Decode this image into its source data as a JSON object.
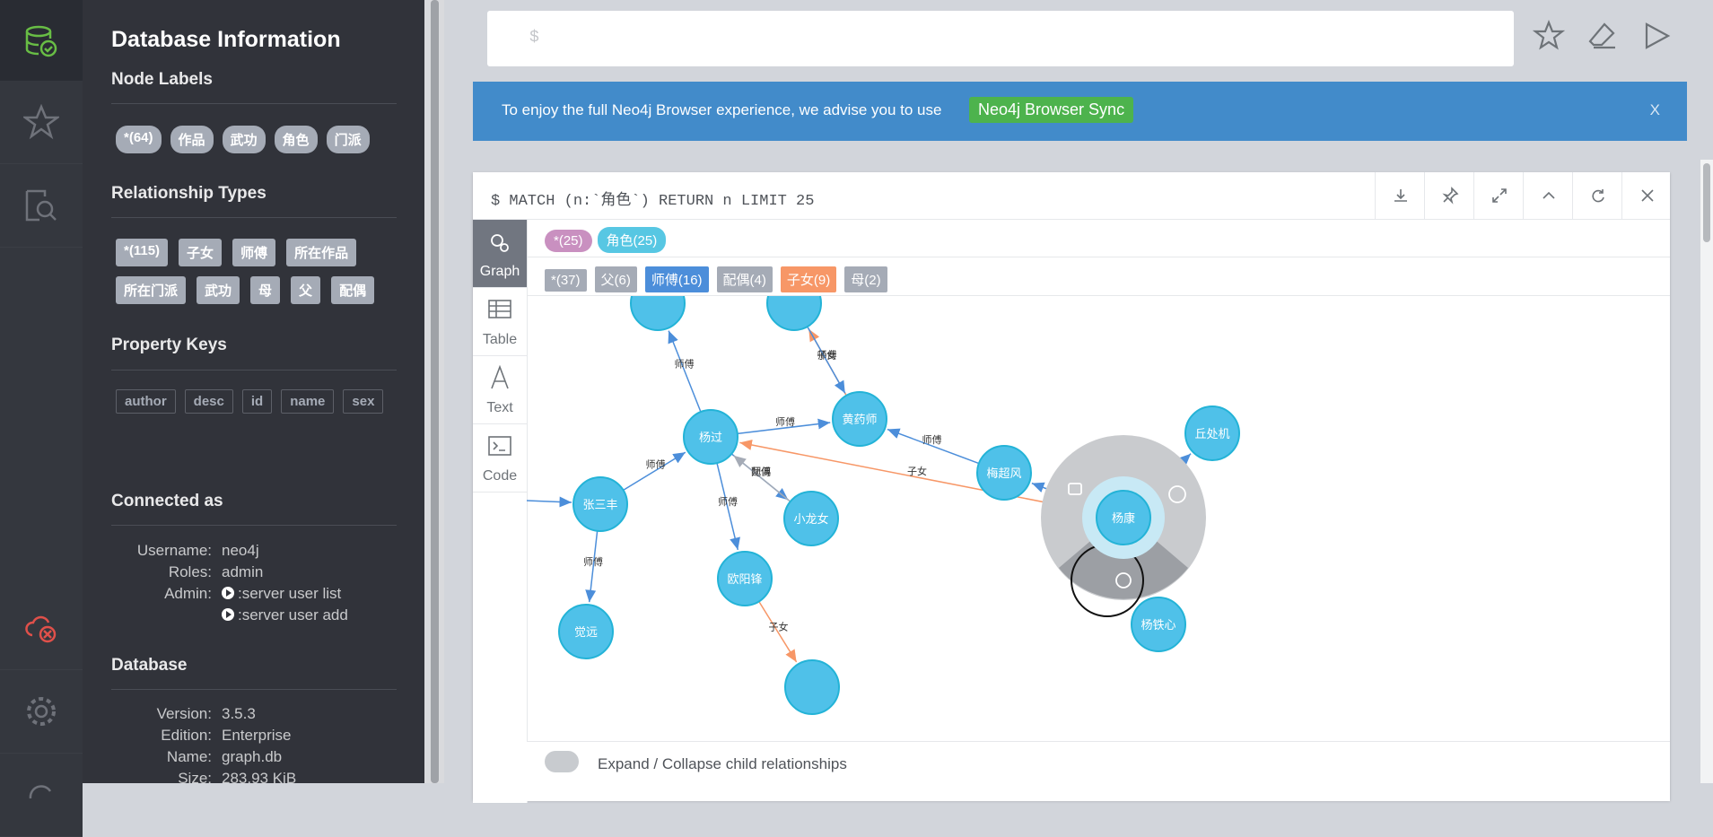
{
  "rail": {
    "items": [
      "database-icon",
      "star-icon",
      "search-doc-icon",
      "cloud-disconnected-icon",
      "gear-icon",
      "sync-icon"
    ]
  },
  "drawer": {
    "title": "Database Information",
    "node_labels": {
      "title": "Node Labels",
      "items": [
        "*(64)",
        "作品",
        "武功",
        "角色",
        "门派"
      ]
    },
    "relationship_types": {
      "title": "Relationship Types",
      "items": [
        "*(115)",
        "子女",
        "师傅",
        "所在作品",
        "所在门派",
        "武功",
        "母",
        "父",
        "配偶"
      ]
    },
    "property_keys": {
      "title": "Property Keys",
      "items": [
        "author",
        "desc",
        "id",
        "name",
        "sex"
      ]
    },
    "connected_as": {
      "title": "Connected as",
      "username_label": "Username:",
      "username": "neo4j",
      "roles_label": "Roles:",
      "roles": "admin",
      "admin_label": "Admin:",
      "admin_cmd1": ":server user list",
      "admin_cmd2": ":server user add"
    },
    "database": {
      "title": "Database",
      "version_label": "Version:",
      "version": "3.5.3",
      "edition_label": "Edition:",
      "edition": "Enterprise",
      "name_label": "Name:",
      "name": "graph.db",
      "size_label": "Size:",
      "size": "283.93 KiB"
    }
  },
  "editor": {
    "prompt": "$"
  },
  "banner": {
    "message": "To enjoy the full Neo4j Browser experience, we advise you to use",
    "sync_label": "Neo4j Browser Sync",
    "close": "X"
  },
  "frame": {
    "command": "$ MATCH (n:`角色`) RETURN n LIMIT 25",
    "tabs": [
      "Graph",
      "Table",
      "Text",
      "Code"
    ],
    "node_pills": [
      {
        "label": "*(25)",
        "color": "#c990c0"
      },
      {
        "label": "角色(25)",
        "color": "#57c7e3"
      }
    ],
    "rel_tags": [
      {
        "label": "*(37)",
        "color": "#a5abb6"
      },
      {
        "label": "父(6)",
        "color": "#a5abb6"
      },
      {
        "label": "师傅(16)",
        "color": "#4c8eda"
      },
      {
        "label": "配偶(4)",
        "color": "#a5abb6"
      },
      {
        "label": "子女(9)",
        "color": "#f79767"
      },
      {
        "label": "母(2)",
        "color": "#a5abb6"
      }
    ],
    "status_text": "Expand / Collapse child relationships"
  },
  "graph": {
    "node_color": "#4fc1e9",
    "nodes": {
      "yangguo": "杨过",
      "huangyaoshi": "黄药师",
      "zhangsanfeng": "张三丰",
      "xiaolongnv": "小龙女",
      "ouyangfeng": "欧阳锋",
      "jueyuan": "觉远",
      "meichaofeng": "梅超风",
      "yangkang": "杨康",
      "qiuchuji": "丘处机",
      "yangtiexin": "杨铁心"
    },
    "edges": {
      "shifu": "师傅",
      "fu": "父",
      "zinv": "子女",
      "peiou": "配偶"
    }
  }
}
